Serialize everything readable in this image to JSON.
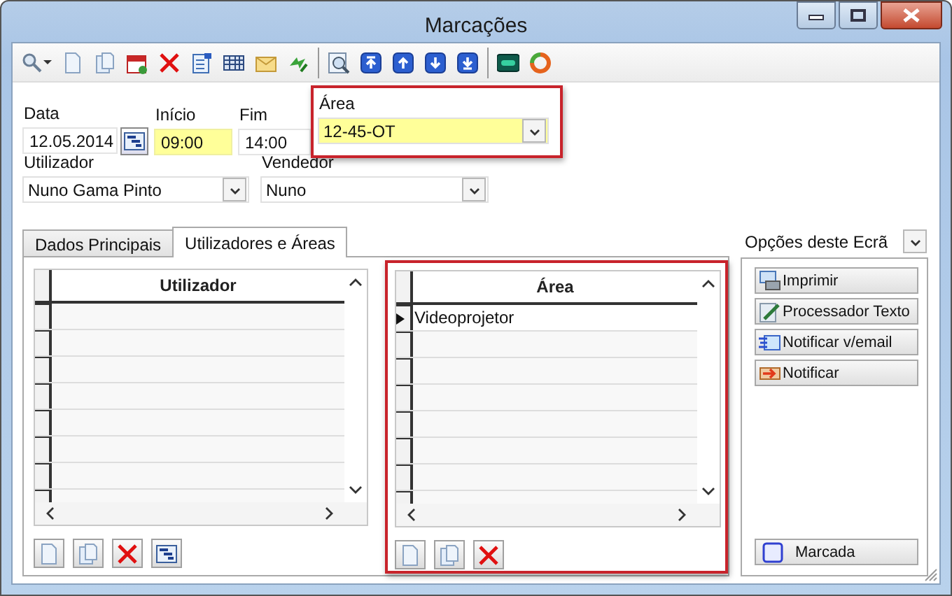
{
  "window": {
    "title": "Marcações"
  },
  "fields": [
    {
      "label": "Data",
      "value": "12.05.2014",
      "required": false,
      "picker": true
    },
    {
      "label": "Início",
      "value": "09:00",
      "required": true
    },
    {
      "label": "Fim",
      "value": "14:00",
      "required": false
    }
  ],
  "area_field": {
    "label": "Área",
    "value": "12-45-OT",
    "required": true
  },
  "combos": [
    {
      "label": "Utilizador",
      "value": "Nuno Gama Pinto"
    },
    {
      "label": "Vendedor",
      "value": "Nuno"
    }
  ],
  "tabs": [
    {
      "label": "Dados Principais",
      "selected": false
    },
    {
      "label": "Utilizadores e Áreas",
      "selected": true
    }
  ],
  "users_grid": {
    "column": "Utilizador"
  },
  "areas_grid": {
    "column": "Área",
    "rows": [
      {
        "text": "Videoprojetor",
        "current": true
      }
    ]
  },
  "options": {
    "title": "Opções deste Ecrã",
    "buttons": [
      {
        "kind": "print",
        "label": "Imprimir"
      },
      {
        "kind": "editor",
        "label": "Processador Texto"
      },
      {
        "kind": "email",
        "label": "Notificar v/email"
      },
      {
        "kind": "notify",
        "label": "Notificar"
      }
    ],
    "status": {
      "label": "Marcada"
    }
  }
}
